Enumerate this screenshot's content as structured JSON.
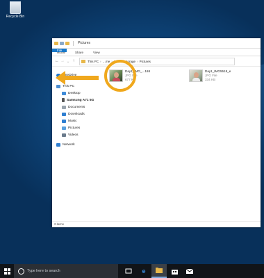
{
  "desktop": {
    "recycle_bin_label": "Recycle Bin"
  },
  "window": {
    "title": "Pictures",
    "ribbon_tabs": [
      "File",
      "Home",
      "Share",
      "View"
    ],
    "breadcrumb": [
      "This PC",
      "…me",
      "Internal storage",
      "Pictures"
    ],
    "nav_pane": [
      {
        "label": "OneDrive",
        "icon": "cloud-icon",
        "color": "#1e78d0"
      },
      {
        "label": "This PC",
        "icon": "pc-icon",
        "color": "#4d8fd1"
      },
      {
        "label": "Desktop",
        "icon": "desktop-icon",
        "color": "#3f8bd8"
      },
      {
        "label": "Samsung A71 5G",
        "icon": "phone-icon",
        "color": "#555555"
      },
      {
        "label": "Documents",
        "icon": "documents-icon",
        "color": "#9aa4ad"
      },
      {
        "label": "Downloads",
        "icon": "download-icon",
        "color": "#2f7fd1"
      },
      {
        "label": "Music",
        "icon": "music-icon",
        "color": "#2f7fd1"
      },
      {
        "label": "Pictures",
        "icon": "pictures-icon",
        "color": "#5aa0de"
      },
      {
        "label": "Videos",
        "icon": "videos-icon",
        "color": "#6b7b8c"
      },
      {
        "label": "Network",
        "icon": "network-icon",
        "color": "#2f7fd1"
      }
    ],
    "files": [
      {
        "name": "Day1_IMG_...168",
        "type": "JPG File",
        "size": "677 KB"
      },
      {
        "name": "Day1_IMG5518_e",
        "type": "JPG File",
        "size": "334 KB"
      }
    ],
    "status": "2 items"
  },
  "taskbar": {
    "search_placeholder": "Type here to search"
  },
  "colors": {
    "accent": "#f0a81d",
    "file_tab": "#1979ca"
  }
}
